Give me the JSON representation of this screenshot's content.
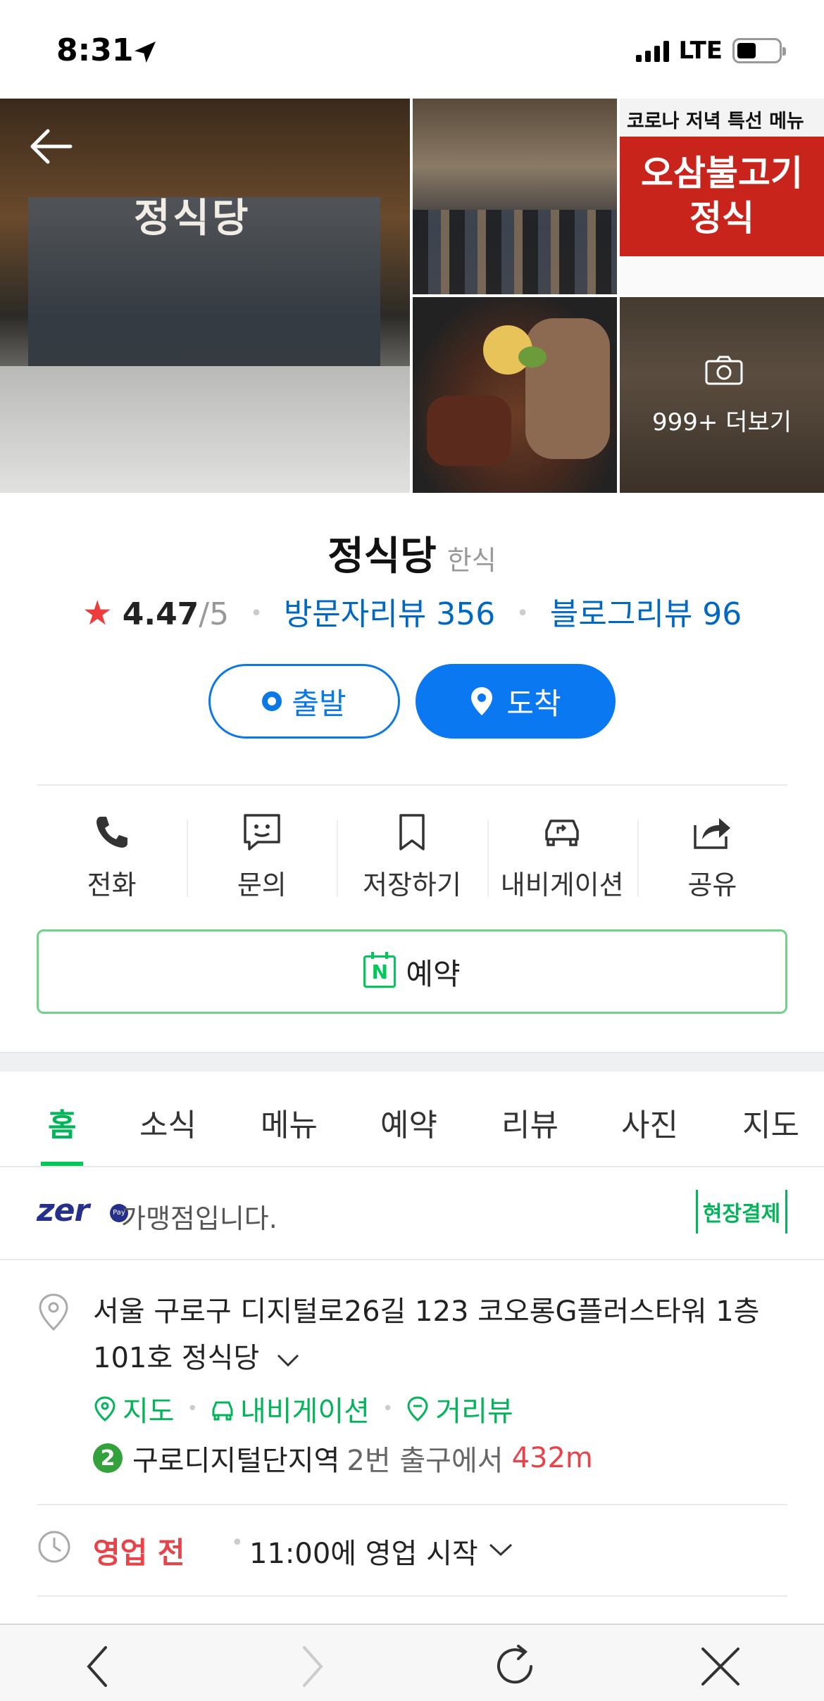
{
  "status_bar": {
    "time": "8:31",
    "network": "LTE"
  },
  "photos": {
    "main_sign": "정식당",
    "menu_banner_top": "코로나 저녁 특선 메뉴",
    "menu_banner_main_line1": "오삼불고기",
    "menu_banner_main_line2": "정식",
    "more_label": "999+ 더보기"
  },
  "place": {
    "name": "정식당",
    "category": "한식",
    "rating": "4.47",
    "rating_max": "/5",
    "visitor_reviews": "방문자리뷰 356",
    "blog_reviews": "블로그리뷰 96"
  },
  "route": {
    "start_label": "출발",
    "arrive_label": "도착"
  },
  "actions": [
    {
      "label": "전화",
      "icon": "phone-icon"
    },
    {
      "label": "문의",
      "icon": "chat-icon"
    },
    {
      "label": "저장하기",
      "icon": "bookmark-icon"
    },
    {
      "label": "내비게이션",
      "icon": "car-navigation-icon"
    },
    {
      "label": "공유",
      "icon": "share-icon"
    }
  ],
  "reserve_button": {
    "label": "예약",
    "icon_letter": "N"
  },
  "tabs": [
    {
      "label": "홈",
      "active": true
    },
    {
      "label": "소식"
    },
    {
      "label": "메뉴"
    },
    {
      "label": "예약"
    },
    {
      "label": "리뷰"
    },
    {
      "label": "사진"
    },
    {
      "label": "지도"
    }
  ],
  "zeropay": {
    "logo": "zer",
    "pay_badge": "Pay",
    "text": "가맹점입니다.",
    "onsite_label": "현장결제"
  },
  "address": {
    "text": "서울 구로구 디지털로26길 123 코오롱G플러스타워 1층 101호 정식당",
    "links": [
      "지도",
      "내비게이션",
      "거리뷰"
    ],
    "subway_line": "2",
    "station": "구로디지털단지역",
    "exit": "2번 출구에서",
    "distance": "432m"
  },
  "hours": {
    "status": "영업 전",
    "detail": "11:00에 영업 시작"
  },
  "colors": {
    "naver_green": "#03c75a",
    "link_blue": "#0068c3",
    "route_blue": "#0a78f0",
    "closed_red": "#e9434a",
    "star_red": "#ee3b3b"
  }
}
